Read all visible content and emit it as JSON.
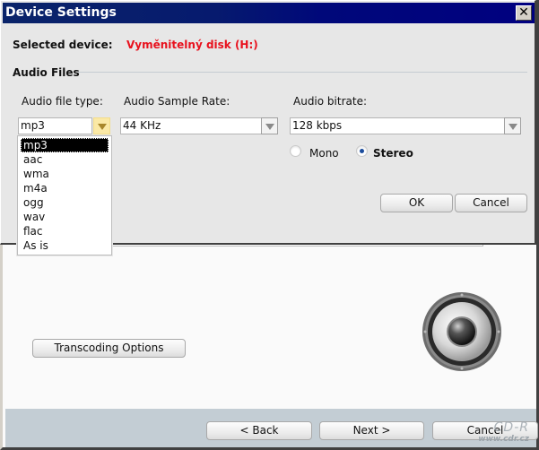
{
  "dialog": {
    "title": "Device Settings",
    "close_glyph": "✕",
    "selected_device_label": "Selected device:",
    "selected_device_value": "Vyměnitelný disk (H:)",
    "group_label": "Audio Files",
    "audio_file_type": {
      "label": "Audio file type:",
      "value": "mp3",
      "options": [
        "mp3",
        "aac",
        "wma",
        "m4a",
        "ogg",
        "wav",
        "flac",
        "As is"
      ],
      "highlighted": "mp3"
    },
    "sample_rate": {
      "label": "Audio Sample Rate:",
      "value": "44 KHz"
    },
    "bitrate": {
      "label": "Audio bitrate:",
      "value": "128 kbps"
    },
    "channels": {
      "options": [
        {
          "label": "Mono",
          "checked": false
        },
        {
          "label": "Stereo",
          "checked": true
        }
      ]
    },
    "ok_label": "OK",
    "cancel_label": "Cancel"
  },
  "wizard": {
    "transcoding_button": "Transcoding Options",
    "back_label": "< Back",
    "next_label": "Next >",
    "cancel_label": "Cancel",
    "speaker_icon": "speaker-icon"
  },
  "watermark": {
    "logo": "CD-R",
    "url": "www.cdr.cz"
  },
  "colors": {
    "titlebar": "#000080",
    "device_value": "#e8111d",
    "footer": "#c3cdd4"
  }
}
